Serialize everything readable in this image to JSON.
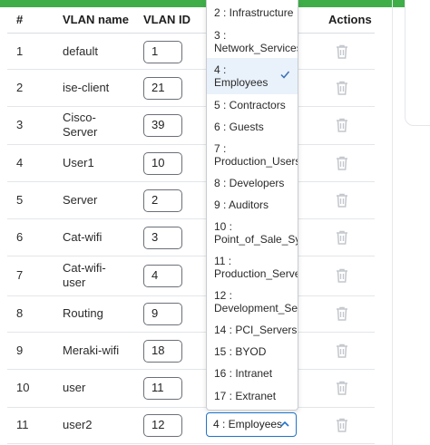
{
  "header": {
    "col_num": "#",
    "col_name": "VLAN name",
    "col_id": "VLAN ID",
    "col_actions": "Actions"
  },
  "rows": [
    {
      "num": "1",
      "name": "default",
      "id": "1"
    },
    {
      "num": "2",
      "name": "ise-client",
      "id": "21"
    },
    {
      "num": "3",
      "name": "Cisco-Server",
      "id": "39"
    },
    {
      "num": "4",
      "name": "User1",
      "id": "10"
    },
    {
      "num": "5",
      "name": "Server",
      "id": "2"
    },
    {
      "num": "6",
      "name": "Cat-wifi",
      "id": "3"
    },
    {
      "num": "7",
      "name": "Cat-wifi-user",
      "id": "4"
    },
    {
      "num": "8",
      "name": "Routing",
      "id": "9"
    },
    {
      "num": "9",
      "name": "Meraki-wifi",
      "id": "18"
    },
    {
      "num": "10",
      "name": "user",
      "id": "11"
    },
    {
      "num": "11",
      "name": "user2",
      "id": "12"
    }
  ],
  "dropdown": {
    "options": [
      "2 : Infrastructure",
      "3 : Network_Services",
      "4 : Employees",
      "5 : Contractors",
      "6 : Guests",
      "7 : Production_Users",
      "8 : Developers",
      "9 : Auditors",
      "10 : Point_of_Sale_Syst",
      "11 : Production_Server",
      "12 : Development_Serv",
      "14 : PCI_Servers",
      "15 : BYOD",
      "16 : Intranet",
      "17 : Extranet"
    ],
    "selected": "4 : Employees"
  },
  "colors": {
    "accent_green": "#3fae49",
    "select_border": "#1f73c9",
    "selected_bg": "#e9f1fb"
  },
  "icons": {
    "row_action": "trash-icon",
    "selected_mark": "check-icon",
    "select_toggle": "chevron-up-icon"
  }
}
